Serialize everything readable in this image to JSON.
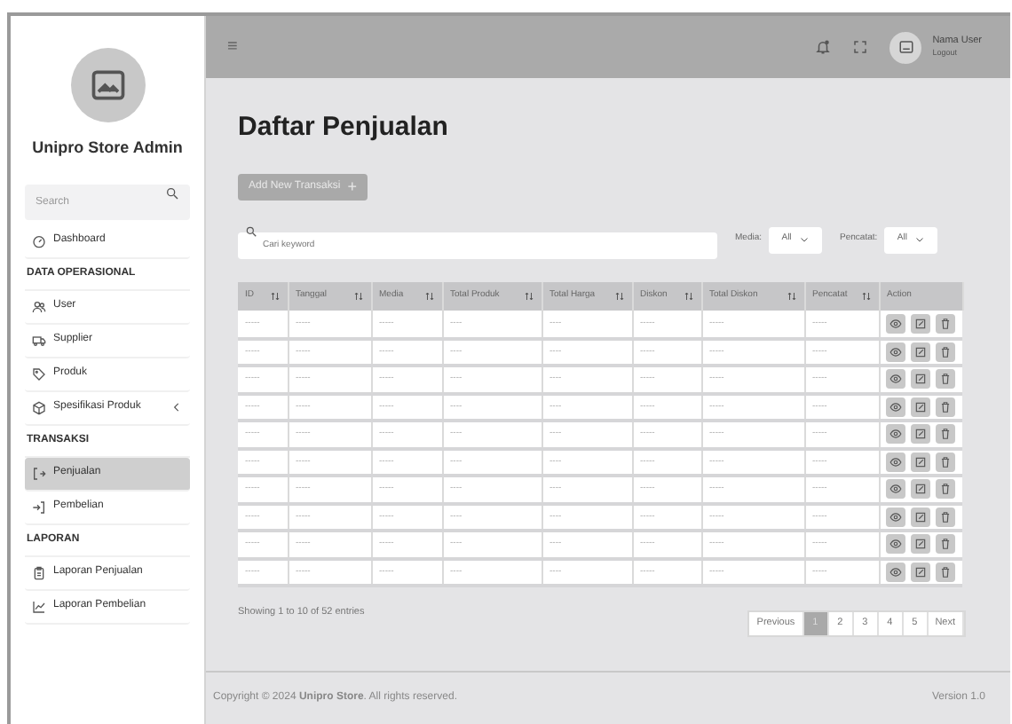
{
  "sidebar": {
    "brand": "Unipro Store Admin",
    "search": {
      "placeholder": "Search"
    },
    "items": [
      {
        "kind": "link",
        "label": "Dashboard",
        "selected": false,
        "expandable": false
      },
      {
        "kind": "heading",
        "label": "DATA OPERASIONAL"
      },
      {
        "kind": "link",
        "label": "User",
        "selected": false,
        "expandable": false
      },
      {
        "kind": "link",
        "label": "Supplier",
        "selected": false,
        "expandable": false
      },
      {
        "kind": "link",
        "label": "Produk",
        "selected": false,
        "expandable": false
      },
      {
        "kind": "link",
        "label": "Spesifikasi Produk",
        "selected": false,
        "expandable": true
      },
      {
        "kind": "heading",
        "label": "TRANSAKSI"
      },
      {
        "kind": "link",
        "label": "Penjualan",
        "selected": true,
        "expandable": false
      },
      {
        "kind": "link",
        "label": "Pembelian",
        "selected": false,
        "expandable": false
      },
      {
        "kind": "heading",
        "label": "LAPORAN"
      },
      {
        "kind": "link",
        "label": "Laporan Penjualan",
        "selected": false,
        "expandable": false
      },
      {
        "kind": "link",
        "label": "Laporan Pembelian",
        "selected": false,
        "expandable": false
      }
    ]
  },
  "topbar": {
    "menu_glyph": "≡",
    "user": {
      "name": "Nama User",
      "action": "Logout"
    }
  },
  "page": {
    "title": "Daftar Penjualan",
    "add_button": "Add New Transaksi",
    "add_glyph": "+",
    "search": {
      "placeholder": "Cari keyword"
    },
    "filters": [
      {
        "label": "Media:",
        "value": "All"
      },
      {
        "label": "Pencatat:",
        "value": "All"
      }
    ],
    "table": {
      "columns": [
        "ID",
        "Tanggal",
        "Media",
        "Total Produk",
        "Total Harga",
        "Diskon",
        "Total Diskon",
        "Pencatat",
        "Action"
      ],
      "rows": [
        [
          "-----",
          "-----",
          "-----",
          "----",
          "----",
          "-----",
          "-----",
          "-----"
        ],
        [
          "-----",
          "-----",
          "-----",
          "----",
          "----",
          "-----",
          "-----",
          "-----"
        ],
        [
          "-----",
          "-----",
          "-----",
          "----",
          "----",
          "-----",
          "-----",
          "-----"
        ],
        [
          "-----",
          "-----",
          "-----",
          "----",
          "----",
          "-----",
          "-----",
          "-----"
        ],
        [
          "-----",
          "-----",
          "-----",
          "----",
          "----",
          "-----",
          "-----",
          "-----"
        ],
        [
          "-----",
          "-----",
          "-----",
          "----",
          "----",
          "-----",
          "-----",
          "-----"
        ],
        [
          "-----",
          "-----",
          "-----",
          "----",
          "----",
          "-----",
          "-----",
          "-----"
        ],
        [
          "-----",
          "-----",
          "-----",
          "----",
          "----",
          "-----",
          "-----",
          "-----"
        ],
        [
          "-----",
          "-----",
          "-----",
          "----",
          "----",
          "-----",
          "-----",
          "-----"
        ],
        [
          "-----",
          "-----",
          "-----",
          "----",
          "----",
          "-----",
          "-----",
          "-----"
        ]
      ]
    },
    "info": "Showing 1 to 10 of 52 entries",
    "pagination": [
      {
        "label": "Previous",
        "selected": false
      },
      {
        "label": "1",
        "selected": true
      },
      {
        "label": "2",
        "selected": false
      },
      {
        "label": "3",
        "selected": false
      },
      {
        "label": "4",
        "selected": false
      },
      {
        "label": "5",
        "selected": false
      },
      {
        "label": "Next",
        "selected": false
      }
    ]
  },
  "footer": {
    "copyright": "Copyright © 2024 **Unipro Store**. All rights reserved.",
    "version": "Version 1.0"
  }
}
